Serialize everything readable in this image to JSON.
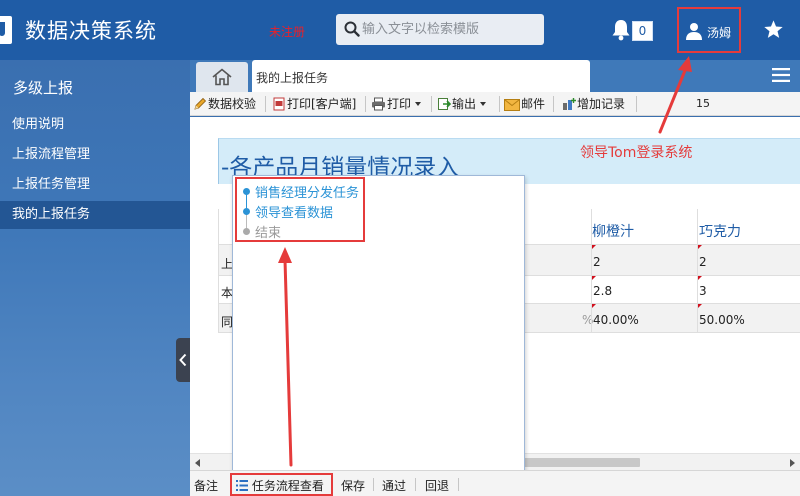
{
  "header": {
    "app_title": "数据决策系统",
    "unregistered": "未注册",
    "search_placeholder": "输入文字以检索模版",
    "notification_count": "0",
    "user_name": "汤姆"
  },
  "sidebar": {
    "title": "多级上报",
    "items": [
      {
        "label": "使用说明",
        "active": false
      },
      {
        "label": "上报流程管理",
        "active": false
      },
      {
        "label": "上报任务管理",
        "active": false
      },
      {
        "label": "我的上报任务",
        "active": true
      }
    ]
  },
  "tabs": {
    "current": "我的上报任务"
  },
  "toolbar": {
    "verify": "数据校验",
    "print_client": "打印[客户端]",
    "print": "打印",
    "export": "输出",
    "mail": "邮件",
    "add_record": "增加记录",
    "page": "15"
  },
  "report": {
    "title": "-各产品月销量情况录入",
    "columns": [
      "柳橙汁",
      "巧克力"
    ],
    "rows": [
      {
        "label": "上",
        "values": [
          "2",
          "2"
        ]
      },
      {
        "label": "本",
        "values": [
          "2.8",
          "3"
        ]
      },
      {
        "label": "同",
        "partial": "%",
        "values": [
          "40.00%",
          "50.00%"
        ]
      }
    ]
  },
  "flow": {
    "steps": [
      {
        "label": "销售经理分发任务",
        "done": true
      },
      {
        "label": "领导查看数据",
        "done": true
      },
      {
        "label": "结束",
        "done": false
      }
    ]
  },
  "bottombar": {
    "remark": "备注",
    "flow_view": "任务流程查看",
    "save": "保存",
    "pass": "通过",
    "reject": "回退"
  },
  "annotation": {
    "text": "领导Tom登录系统"
  },
  "colors": {
    "header_bg": "#1f5ca6",
    "sidebar_active": "#235694",
    "accent_blue": "#2b93d6",
    "annotation_red": "#e53b3b",
    "flag_red": "#d1101d"
  }
}
